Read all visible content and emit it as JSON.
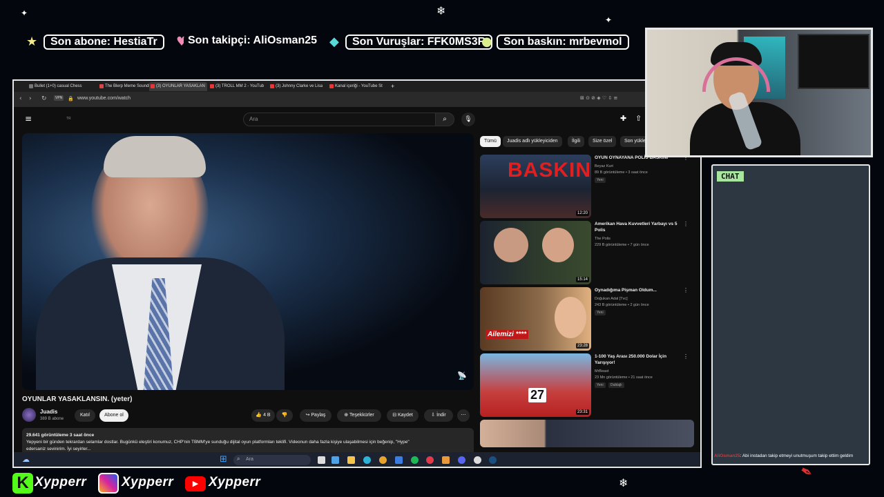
{
  "overlay": {
    "stats": [
      {
        "label": "Son abone: HestiaTr"
      },
      {
        "label": "Son takipçi: AliOsman25"
      },
      {
        "label": "Son Vuruşlar: FFK0MS3R"
      },
      {
        "label": "Son baskın: mrbevmol"
      }
    ],
    "chat_label": "CHAT",
    "chat_message": {
      "user": "AliOsman25",
      "text": ": Abi instadan takip etmeyi unutmuşum takip ettim geldim"
    },
    "socials": [
      "Xypperr",
      "Xypperr",
      "Xypperr"
    ],
    "colors": {
      "chat_label_bg": "#a8e6a0",
      "chat_bg": "#2d3742",
      "instagram": "#d6249f",
      "youtube": "#ff0000",
      "kick": "#53fc18"
    }
  },
  "browser": {
    "tabs": [
      {
        "label": "Bullet (1+0) casual Chess"
      },
      {
        "label": "The Blerp Meme Soundbo"
      },
      {
        "label": "(3) OYUNLAR YASAKLAN"
      },
      {
        "label": "(3) TROLL MM 2 - YouTub"
      },
      {
        "label": "(3) Johnny Clarke ve Lisa"
      },
      {
        "label": "Kanal içeriği - YouTube St"
      }
    ],
    "vpn_label": "VPN",
    "url": "www.youtube.com/watch"
  },
  "youtube": {
    "logo_region": "TR",
    "search_placeholder": "Ara",
    "video": {
      "title": "OYUNLAR YASAKLANSIN. (yeter)",
      "channel": "Juadis",
      "subscribers": "389 B abone",
      "join_label": "Katıl",
      "subscribed_label": "Abone ol",
      "likes": "4 B",
      "share_label": "Paylaş",
      "thanks_label": "Teşekkürler",
      "save_label": "Kaydet",
      "download_label": "İndir",
      "views_time": "29.641 görüntüleme  3 saat önce",
      "description": "Yepyeni bir günden tekrardan selamlar dostlar. Bugünkü eleştiri konumuz, CHP'nin TBMM'ye sunduğu dijital oyun platformları teklifi. Videonun daha fazla kişiye ulaşabilmesi için beğenip, \"Hype\"",
      "description_more": "edersaniz sevinirim. İyi seyirler..."
    },
    "chips": [
      "Tümü",
      "Juadis adlı yükleyiciden",
      "İlgili",
      "Size özel",
      "Son yüklen"
    ],
    "recommended": [
      {
        "title": "OYUN OYNAYANA POLİS BASKINI",
        "channel": "Beyaz Kurt",
        "meta": "89 B görüntüleme • 3 saat önce",
        "badge": "Yeni",
        "duration": "12:20",
        "thumb_text": "BASKIN"
      },
      {
        "title": "Amerikan Hava Kuvvetleri Yarbayı vs 5 Polis",
        "channel": "The Polis",
        "meta": "229 B görüntüleme • 7 gün önce",
        "badge": "",
        "duration": "15:14",
        "thumb_text": ""
      },
      {
        "title": "Oynadığıma Pişman Oldum...",
        "channel": "Doğukan Adal [Tvc]",
        "meta": "243 B görüntüleme • 2 gün önce",
        "badge": "Yeni",
        "duration": "23:28",
        "thumb_text": "Ailemizi ****"
      },
      {
        "title": "1-100 Yaş Arası 250.000 Dolar İçin Yarışıyor!",
        "channel": "MrBeast",
        "meta": "23 Mn görüntüleme • 21 saat önce",
        "badge": "Yeni",
        "badge2": "Dublajlı",
        "duration": "23:31",
        "thumb_text": "27"
      }
    ]
  },
  "taskbar": {
    "search_placeholder": "Ara"
  }
}
